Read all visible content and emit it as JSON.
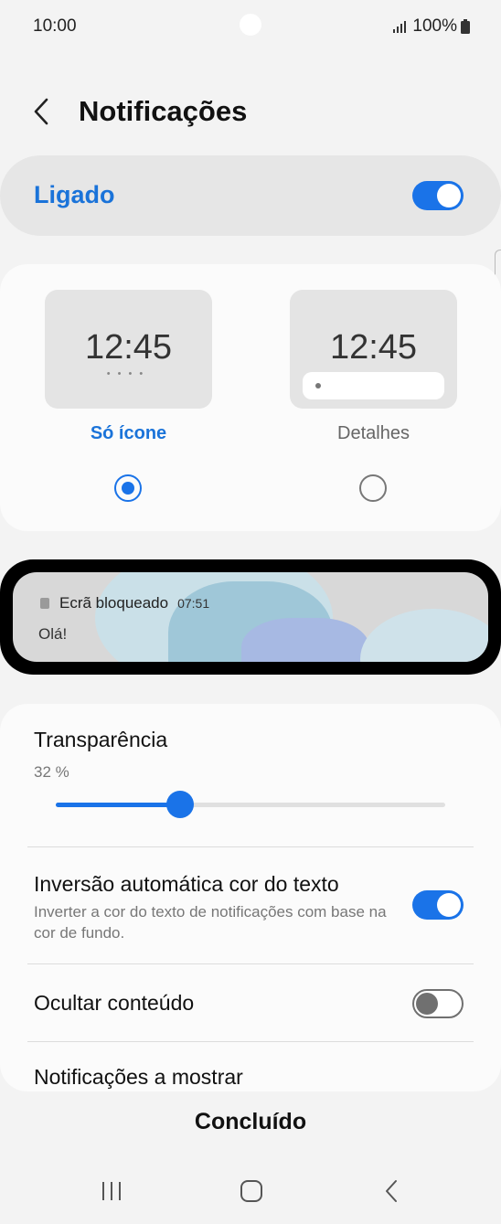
{
  "status_bar": {
    "time": "10:00",
    "battery": "100%"
  },
  "header": {
    "title": "Notificações"
  },
  "master": {
    "label": "Ligado",
    "enabled": true
  },
  "styles": {
    "options": [
      {
        "label": "Só ícone",
        "clock": "12:45",
        "selected": true
      },
      {
        "label": "Detalhes",
        "clock": "12:45",
        "selected": false
      }
    ],
    "dots": "••••"
  },
  "preview": {
    "app": "Ecrã bloqueado",
    "time": "07:51",
    "message": "Olá!"
  },
  "transparency": {
    "title": "Transparência",
    "value_text": "32 %",
    "value": 0.32
  },
  "invert": {
    "title": "Inversão automática cor do texto",
    "subtitle": "Inverter a cor do texto de notificações com base na cor de fundo.",
    "enabled": true
  },
  "hide_content": {
    "title": "Ocultar conteúdo",
    "enabled": false
  },
  "show_notifications": {
    "title": "Notificações a mostrar"
  },
  "footer": {
    "done_label": "Concluído"
  },
  "colors": {
    "accent": "#1a73e8",
    "background": "#f3f3f3",
    "card": "#fbfbfb"
  }
}
